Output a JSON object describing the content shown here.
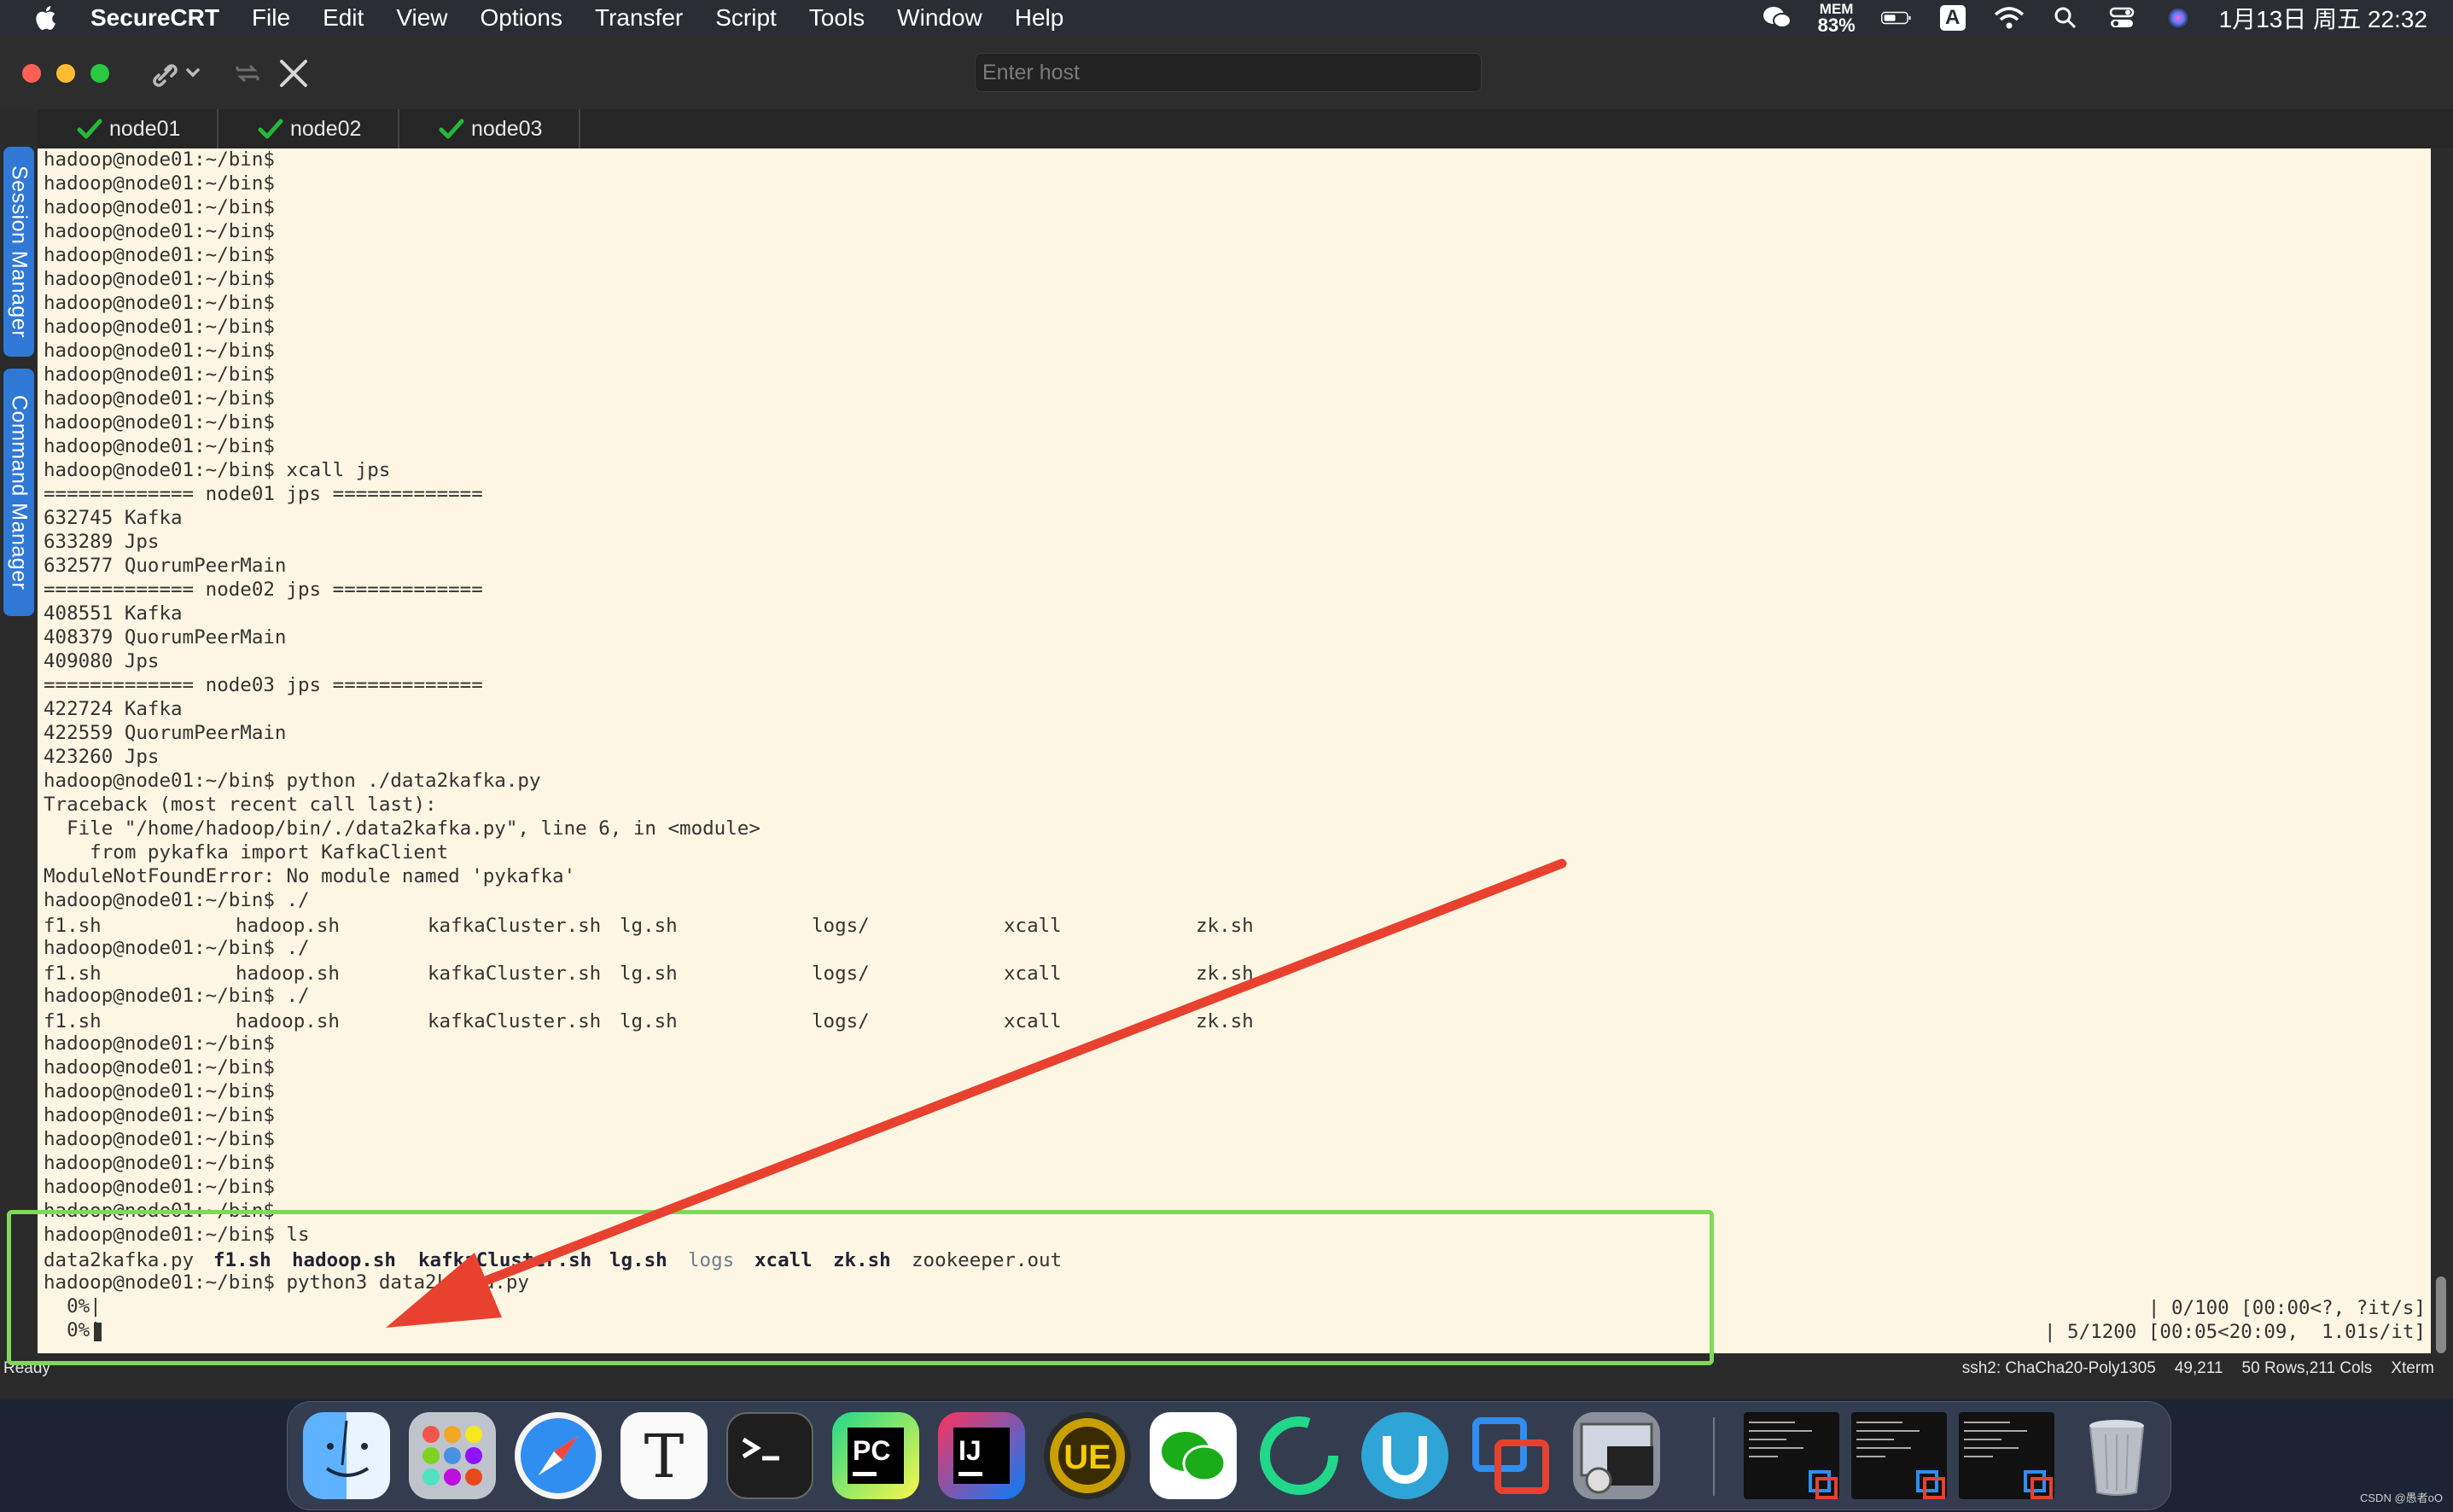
{
  "menubar": {
    "app_name": "SecureCRT",
    "menus": [
      "File",
      "Edit",
      "View",
      "Options",
      "Transfer",
      "Script",
      "Tools",
      "Window",
      "Help"
    ],
    "mem_label": "MEM",
    "mem_value": "83%",
    "input_source": "A",
    "clock": "1月13日 周五  22:32"
  },
  "toolbar": {
    "host_placeholder": "Enter host"
  },
  "tabs": [
    {
      "label": "node01",
      "status_icon": "checkmark-icon",
      "status_color": "#27b83a"
    },
    {
      "label": "node02",
      "status_icon": "checkmark-icon",
      "status_color": "#27b83a"
    },
    {
      "label": "node03",
      "status_icon": "checkmark-icon",
      "status_color": "#27b83a"
    }
  ],
  "sidebar": {
    "session_manager": "Session Manager",
    "command_manager": "Command Manager"
  },
  "terminal": {
    "lines": [
      "hadoop@node01:~/bin$",
      "hadoop@node01:~/bin$",
      "hadoop@node01:~/bin$",
      "hadoop@node01:~/bin$",
      "hadoop@node01:~/bin$",
      "hadoop@node01:~/bin$",
      "hadoop@node01:~/bin$",
      "hadoop@node01:~/bin$",
      "hadoop@node01:~/bin$",
      "hadoop@node01:~/bin$",
      "hadoop@node01:~/bin$",
      "hadoop@node01:~/bin$",
      "hadoop@node01:~/bin$",
      "hadoop@node01:~/bin$ xcall jps",
      "============= node01 jps =============",
      "632745 Kafka",
      "633289 Jps",
      "632577 QuorumPeerMain",
      "============= node02 jps =============",
      "408551 Kafka",
      "408379 QuorumPeerMain",
      "409080 Jps",
      "============= node03 jps =============",
      "422724 Kafka",
      "422559 QuorumPeerMain",
      "423260 Jps",
      "hadoop@node01:~/bin$ python ./data2kafka.py",
      "Traceback (most recent call last):",
      "  File \"/home/hadoop/bin/./data2kafka.py\", line 6, in <module>",
      "    from pykafka import KafkaClient",
      "ModuleNotFoundError: No module named 'pykafka'",
      "hadoop@node01:~/bin$ ./",
      "",
      "hadoop@node01:~/bin$ ./",
      "",
      "hadoop@node01:~/bin$ ./",
      "",
      "hadoop@node01:~/bin$",
      "hadoop@node01:~/bin$",
      "hadoop@node01:~/bin$",
      "hadoop@node01:~/bin$",
      "hadoop@node01:~/bin$",
      "hadoop@node01:~/bin$",
      "hadoop@node01:~/bin$",
      "hadoop@node01:~/bin$",
      "hadoop@node01:~/bin$ ls",
      "",
      "hadoop@node01:~/bin$ python3 data2kafka.py",
      "  0%|",
      "  0%|"
    ],
    "completion_row": [
      "f1.sh",
      "hadoop.sh",
      "kafkaCluster.sh",
      "lg.sh",
      "logs/",
      "xcall",
      "zk.sh"
    ],
    "ls_row": [
      "data2kafka.py",
      "f1.sh",
      "hadoop.sh",
      "kafkaCluster.sh",
      "lg.sh",
      "logs",
      "xcall",
      "zk.sh",
      "zookeeper.out"
    ],
    "progress_1": "| 0/100 [00:00<?, ?it/s]",
    "progress_2": "| 5/1200 [00:05<20:09,  1.01s/it]",
    "progress_2_fraction": 0.0042
  },
  "statusbar": {
    "ready": "Ready",
    "cipher": "ssh2: ChaCha20-Poly1305",
    "cursor": "49,211",
    "size": "50 Rows,211 Cols",
    "term": "Xterm"
  },
  "watermark": "CSDN @愚者oO",
  "colors": {
    "terminal_bg": "#fdf6e3",
    "highlight": "#7ed957",
    "arrow": "#e8412f",
    "tab_ok": "#27b83a",
    "side_tab": "#2f78d6"
  },
  "dock": [
    "finder-icon",
    "launchpad-icon",
    "safari-icon",
    "typora-icon",
    "terminal-icon",
    "pycharm-icon",
    "intellij-icon",
    "ultraedit-icon",
    "wechat-icon",
    "pycharm-ce-icon",
    "upscale-icon",
    "vmware-icon",
    "securecrt-icon",
    "window-thumb-icon",
    "window-thumb-icon",
    "window-thumb-icon",
    "trash-icon"
  ]
}
